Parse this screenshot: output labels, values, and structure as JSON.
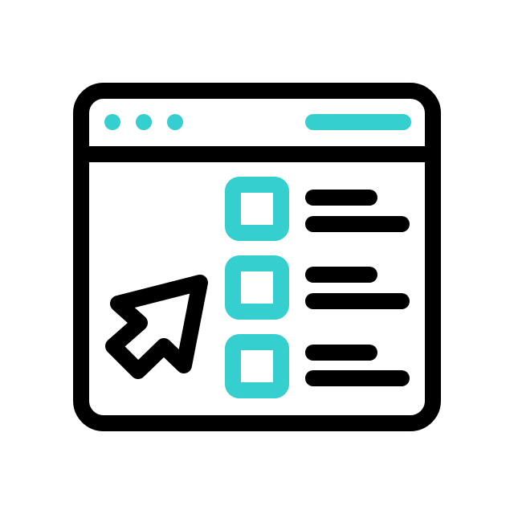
{
  "icon": {
    "name": "browser-checklist-cursor-icon",
    "colors": {
      "outline": "#000000",
      "accent": "#35CFCF",
      "background": "#FFFFFF"
    },
    "window_dots": 3,
    "checklist_items": [
      {
        "checked": false
      },
      {
        "checked": false
      },
      {
        "checked": false
      }
    ],
    "cursor": "arrow-pointer-icon"
  }
}
